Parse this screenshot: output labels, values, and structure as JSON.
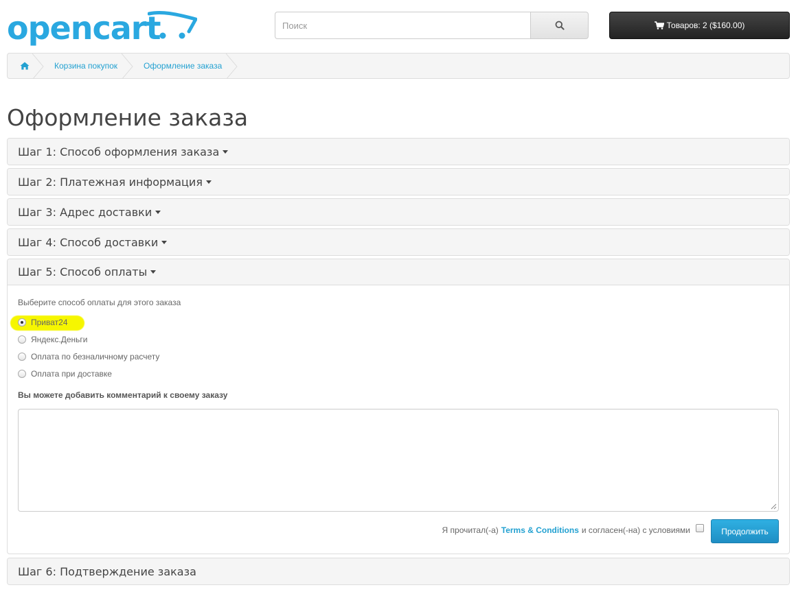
{
  "header": {
    "logo_text": "opencart",
    "search_placeholder": "Поиск",
    "cart_label": "Товаров: 2 ($160.00)"
  },
  "breadcrumb": {
    "items": [
      {
        "label": "Корзина покупок"
      },
      {
        "label": "Оформление заказа"
      }
    ]
  },
  "page_title": "Оформление заказа",
  "steps": [
    {
      "label": "Шаг 1: Способ оформления заказа"
    },
    {
      "label": "Шаг 2: Платежная информация"
    },
    {
      "label": "Шаг 3: Адрес доставки"
    },
    {
      "label": "Шаг 4: Способ доставки"
    },
    {
      "label": "Шаг 5: Способ оплаты"
    },
    {
      "label": "Шаг 6: Подтверждение заказа"
    }
  ],
  "payment": {
    "description": "Выберите способ оплаты для этого заказа",
    "methods": [
      {
        "label": "Приват24",
        "selected": true
      },
      {
        "label": "Яндекс.Деньги",
        "selected": false
      },
      {
        "label": "Оплата по безналичному расчету",
        "selected": false
      },
      {
        "label": "Оплата при доставке",
        "selected": false
      }
    ],
    "comment_label": "Вы можете добавить комментарий к своему заказу",
    "comment_value": "",
    "agree_prefix": "Я прочитал(-а)",
    "agree_link": "Terms & Conditions",
    "agree_suffix": "и согласен(-на) с условиями",
    "continue_label": "Продолжить"
  },
  "colors": {
    "link": "#23a1d1",
    "brand": "#2aa8e0",
    "highlight": "#f6f600",
    "primary_button": "#1f8ec4"
  }
}
